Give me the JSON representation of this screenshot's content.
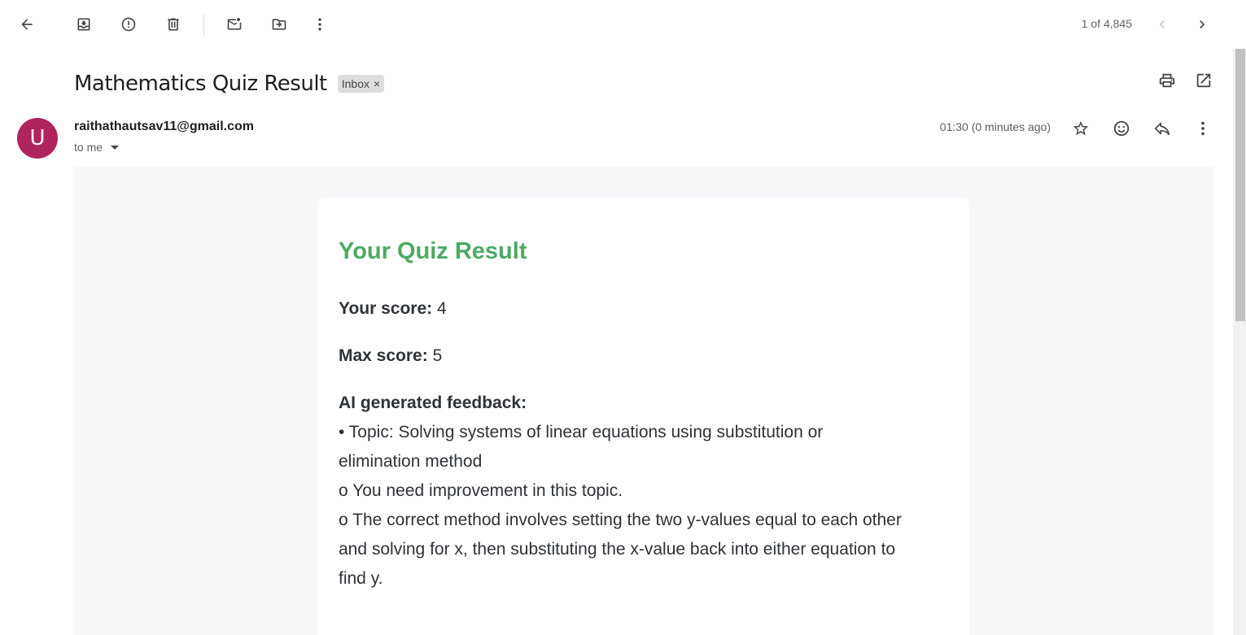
{
  "toolbar": {
    "back_icon": "arrow-left-icon",
    "archive_icon": "archive-icon",
    "spam_icon": "report-spam-icon",
    "delete_icon": "trash-icon",
    "unread_icon": "mark-unread-icon",
    "move_icon": "move-to-folder-icon",
    "more_icon": "more-vert-icon",
    "pager": "1 of 4,845",
    "prev_icon": "chevron-left-icon",
    "next_icon": "chevron-right-icon"
  },
  "subject": {
    "title": "Mathematics Quiz Result",
    "label": "Inbox",
    "label_remove": "×"
  },
  "sender": {
    "avatar_letter": "U",
    "avatar_color": "#b0245e",
    "email": "raithathautsav11@gmail.com",
    "recipient": "to me",
    "time": "01:30 (0 minutes ago)"
  },
  "message": {
    "heading": "Your Quiz Result",
    "heading_color": "#4caa64",
    "score_label": "Your score:",
    "score_value": "4",
    "max_label": "Max score:",
    "max_value": "5",
    "feedback_label": "AI generated feedback:",
    "feedback_lines": [
      "• Topic: Solving systems of linear equations using substitution or",
      "elimination method",
      "o You need improvement in this topic.",
      "o The correct method involves setting the two y-values equal to each other",
      "and solving for x, then substituting the x-value back into either equation to",
      "find y."
    ]
  }
}
